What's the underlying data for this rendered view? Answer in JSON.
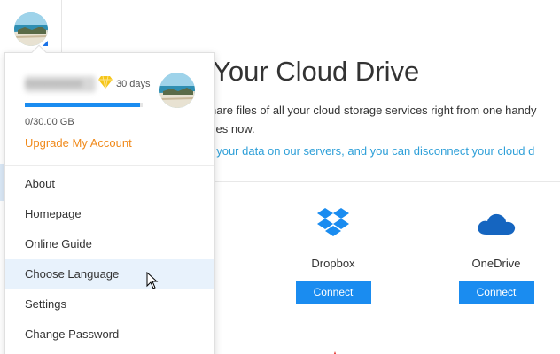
{
  "header": {
    "avatar_icon": "beach-avatar-icon"
  },
  "main": {
    "title": "Your Cloud Drive",
    "description_line1": "hare files of all your cloud storage services right from one handy",
    "description_line2": "ves now.",
    "info_link": "f your data on our servers, and you can disconnect your cloud d",
    "services": [
      {
        "name": "Dropbox",
        "button": "Connect",
        "icon": "dropbox-icon",
        "color": "#1a8cf0"
      },
      {
        "name": "OneDrive",
        "button": "Connect",
        "icon": "onedrive-icon",
        "color": "#1565c0"
      }
    ]
  },
  "account_menu": {
    "username": "xxxxxxxxxx",
    "vip_days": "30 days",
    "vip_icon": "diamond-icon",
    "storage_text": "0/30.00 GB",
    "storage_fill_fraction": 0.98,
    "upgrade_label": "Upgrade My Account",
    "items": [
      {
        "label": "About"
      },
      {
        "label": "Homepage"
      },
      {
        "label": "Online Guide"
      },
      {
        "label": "Choose Language",
        "hovered": true
      },
      {
        "label": "Settings"
      },
      {
        "label": "Change Password"
      }
    ]
  },
  "colors": {
    "accent": "#1a8cf0",
    "upgrade": "#f0891a",
    "link": "#2d9fd8",
    "vip": "#f5c518"
  }
}
